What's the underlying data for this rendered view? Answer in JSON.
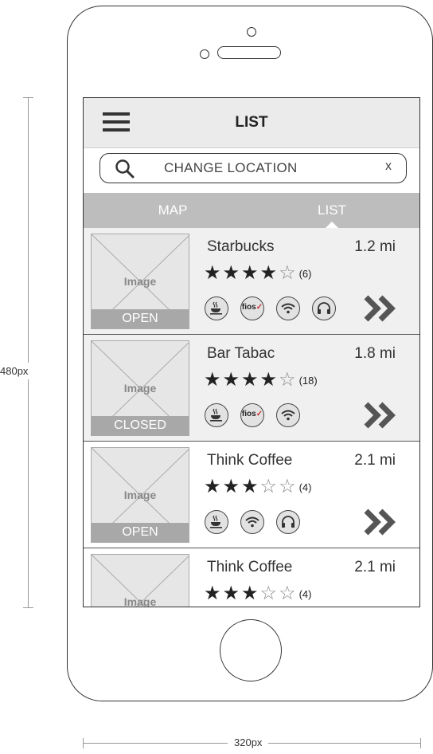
{
  "annotations": {
    "height_label": "480px",
    "width_label": "320px"
  },
  "header": {
    "title": "LIST"
  },
  "search": {
    "placeholder": "CHANGE LOCATION",
    "clear_label": "x"
  },
  "tabs": [
    {
      "label": "MAP",
      "active": false
    },
    {
      "label": "LIST",
      "active": true
    }
  ],
  "places": [
    {
      "name": "Starbucks",
      "distance": "1.2 mi",
      "rating": 4,
      "rating_max": 5,
      "review_count": "(6)",
      "status": "OPEN",
      "image_label": "Image",
      "amenities": [
        "coffee-icon",
        "fios-icon",
        "wifi-icon",
        "headphones-icon"
      ]
    },
    {
      "name": "Bar Tabac",
      "distance": "1.8 mi",
      "rating": 4,
      "rating_max": 5,
      "review_count": "(18)",
      "status": "CLOSED",
      "image_label": "Image",
      "amenities": [
        "coffee-icon",
        "fios-icon",
        "wifi-icon"
      ]
    },
    {
      "name": "Think Coffee",
      "distance": "2.1 mi",
      "rating": 3,
      "rating_max": 5,
      "review_count": "(4)",
      "status": "OPEN",
      "image_label": "Image",
      "amenities": [
        "coffee-icon",
        "wifi-icon",
        "headphones-icon"
      ]
    },
    {
      "name": "Think Coffee",
      "distance": "2.1 mi",
      "rating": 3,
      "rating_max": 5,
      "review_count": "(4)",
      "status": "",
      "image_label": "Image",
      "amenities": []
    }
  ],
  "fios_text": "fios",
  "colors": {
    "header_bg": "#ebebeb",
    "tab_bar_bg": "#bdbdbd",
    "status_bar_bg": "#a8a8a8",
    "row_shaded_bg": "#f0f0f0",
    "outline": "#333333"
  }
}
